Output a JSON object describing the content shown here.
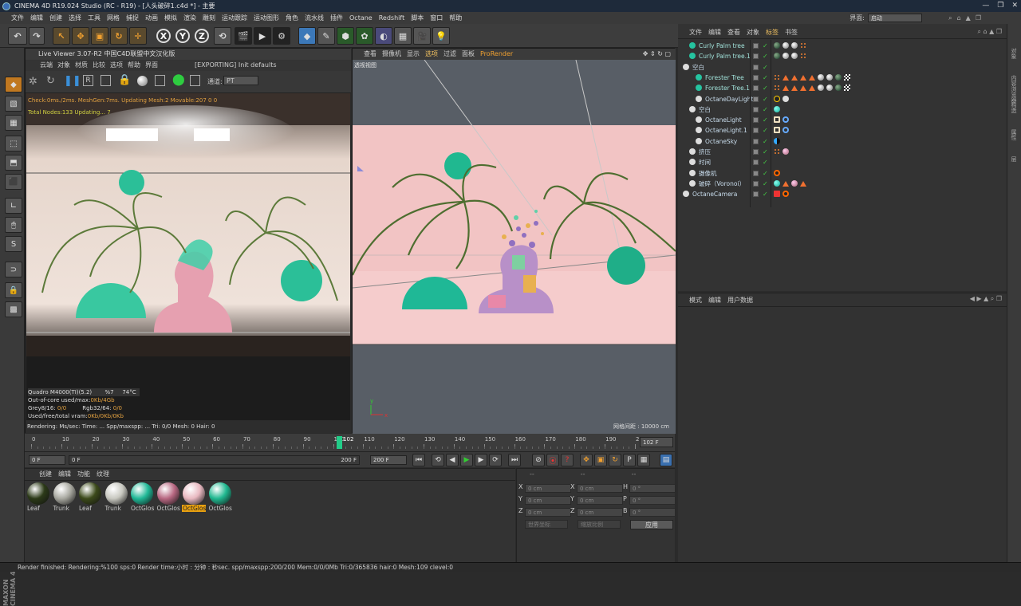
{
  "window": {
    "title": "CINEMA 4D R19.024 Studio (RC - R19) - [人头破碎1.c4d *] - 主要",
    "buttons": [
      "—",
      "❐",
      "✕"
    ]
  },
  "menubar": [
    "文件",
    "编辑",
    "创建",
    "选择",
    "工具",
    "网格",
    "捕捉",
    "动画",
    "模拟",
    "渲染",
    "雕刻",
    "运动跟踪",
    "运动图形",
    "角色",
    "流水线",
    "插件",
    "Octane",
    "Redshift",
    "脚本",
    "窗口",
    "帮助"
  ],
  "layout": {
    "label": "界面:",
    "value": "启动"
  },
  "toolbar": {
    "x": "X",
    "y": "Y",
    "z": "Z"
  },
  "liveviewer": {
    "title": "Live Viewer 3.07-R2 中国C4D联盟中文汉化版",
    "menu": [
      "云端",
      "对象",
      "材质",
      "比较",
      "选项",
      "帮助",
      "界面"
    ],
    "exporting": "[EXPORTING] Init defaults",
    "channel_label": "通道:",
    "channel_value": "PT",
    "overlay1": "Check:0ms./2ms. MeshGen:7ms. Updating Mesh:2 Movable:207  0 0",
    "overlay2": "Total Nodes:133  Updating...  7",
    "gpu": "Quadro M4000(TI)(5.2)",
    "gpu_pct": "%7",
    "gpu_temp": "74°C",
    "outofcore_label": "Out-of-core used/max:",
    "outofcore_value": "0Kb/4Gb",
    "grey_label": "Grey8/16:",
    "grey_value": "0/0",
    "rgb_label": "Rgb32/64:",
    "rgb_value": "0/0",
    "vram_label": "Used/free/total vram:",
    "vram_value": "0Kb/0Kb/0Kb",
    "rendering": "Rendering:      Ms/sec:   Time: ...     Spp/maxspp: ...    Tri: 0/0    Mesh: 0      Hair: 0"
  },
  "viewport": {
    "menu": [
      "查看",
      "摄像机",
      "显示",
      "选项",
      "过滤",
      "面板",
      "ProRender"
    ],
    "label": "透视视图",
    "grid": "网格间距 : 10000 cm",
    "axis_y": "y",
    "axis_x": "x"
  },
  "objectmanager": {
    "menu": [
      "文件",
      "编辑",
      "查看",
      "对象",
      "标签",
      "书签"
    ],
    "objects": [
      {
        "name": "Curly Palm tree",
        "indent": 1,
        "color": "#25c4a0",
        "tags": [
          "ball-dark",
          "ball-grey",
          "ball-grey",
          "dots"
        ]
      },
      {
        "name": "Curly Palm tree.1",
        "indent": 1,
        "color": "#25c4a0",
        "tags": [
          "ball-dark",
          "ball-grey",
          "ball-grey",
          "dots"
        ]
      },
      {
        "name": "空白",
        "indent": 0,
        "color": "#ddd",
        "tags": []
      },
      {
        "name": "Forester Tree",
        "indent": 2,
        "color": "#25c4a0",
        "tags": [
          "dots",
          "tri",
          "tri",
          "tri",
          "tri",
          "ball-grey",
          "ball-grey",
          "ball-dark",
          "check"
        ]
      },
      {
        "name": "Forester Tree.1",
        "indent": 2,
        "color": "#25c4a0",
        "tags": [
          "dots",
          "tri",
          "tri",
          "tri",
          "tri",
          "ball-grey",
          "ball-grey",
          "ball-dark",
          "check"
        ]
      },
      {
        "name": "OctaneDayLight",
        "indent": 2,
        "color": "#ddd",
        "tags": [
          "sun",
          "gear"
        ]
      },
      {
        "name": "空白",
        "indent": 1,
        "color": "#ddd",
        "tags": [
          "ball-teal"
        ]
      },
      {
        "name": "OctaneLight",
        "indent": 2,
        "color": "#ddd",
        "tags": [
          "light",
          "ring"
        ]
      },
      {
        "name": "OctaneLight.1",
        "indent": 2,
        "color": "#ddd",
        "tags": [
          "light",
          "ring"
        ]
      },
      {
        "name": "OctaneSky",
        "indent": 2,
        "color": "#ddd",
        "tags": [
          "half"
        ]
      },
      {
        "name": "挤压",
        "indent": 1,
        "color": "#ddd",
        "tags": [
          "dots",
          "ball-pink"
        ]
      },
      {
        "name": "时间",
        "indent": 1,
        "color": "#ddd",
        "tags": []
      },
      {
        "name": "摄像机",
        "indent": 1,
        "color": "#ddd",
        "tags": [
          "noentry"
        ]
      },
      {
        "name": "破碎（Voronoi）",
        "indent": 1,
        "color": "#ddd",
        "tags": [
          "ball-teal",
          "tri",
          "ball-pink",
          "tri"
        ]
      },
      {
        "name": "OctaneCamera",
        "indent": 0,
        "color": "#ddd",
        "tags": [
          "cam",
          "noentry"
        ]
      }
    ]
  },
  "attributes": {
    "menu": [
      "模式",
      "编辑",
      "用户数据"
    ]
  },
  "rightstrip": [
    "对象",
    "内容浏览器",
    "构造",
    "属性",
    "层"
  ],
  "timeline": {
    "ticks": [
      "0",
      "10",
      "20",
      "30",
      "40",
      "50",
      "60",
      "70",
      "80",
      "90",
      "100",
      "110",
      "120",
      "130",
      "140",
      "150",
      "160",
      "170",
      "180",
      "190",
      "200"
    ],
    "current": "102",
    "current_field": "102 F"
  },
  "transport": {
    "start": "0 F",
    "start2": "0 F",
    "end": "200 F",
    "end2": "200 F"
  },
  "materials": {
    "menu": [
      "创建",
      "编辑",
      "功能",
      "纹理"
    ],
    "items": [
      {
        "label": "Leaf",
        "color": "#2c3a18",
        "selected": false
      },
      {
        "label": "Trunk",
        "color": "#a8a8a0",
        "selected": false
      },
      {
        "label": "Leaf",
        "color": "#3c4a1a",
        "selected": false
      },
      {
        "label": "Trunk",
        "color": "#c8c8c0",
        "selected": false
      },
      {
        "label": "OctGlos",
        "color": "#1fb896",
        "selected": false
      },
      {
        "label": "OctGlos",
        "color": "#b86882",
        "selected": false
      },
      {
        "label": "OctGlos",
        "color": "#e8b8c0",
        "selected": true
      },
      {
        "label": "OctGlos",
        "color": "#20b890",
        "selected": false
      }
    ]
  },
  "coordinates": {
    "header": [
      "--",
      "--",
      "--"
    ],
    "rows": [
      {
        "a": "X",
        "av": "0 cm",
        "b": "X",
        "bv": "0 cm",
        "c": "H",
        "cv": "0 °"
      },
      {
        "a": "Y",
        "av": "0 cm",
        "b": "Y",
        "bv": "0 cm",
        "c": "P",
        "cv": "0 °"
      },
      {
        "a": "Z",
        "av": "0 cm",
        "b": "Z",
        "bv": "0 cm",
        "c": "B",
        "cv": "0 °"
      }
    ],
    "world": "世界坐标",
    "scale": "缩放比例",
    "apply": "应用"
  },
  "brand": "MAXON CINEMA 4D",
  "status": "Render finished: Rendering:%100 sps:0 Render time:小时 : 分钟 : 秒sec. spp/maxspp:200/200 Mem:0/0/0Mb Tri:0/365836 hair:0 Mesh:109 clevel:0"
}
